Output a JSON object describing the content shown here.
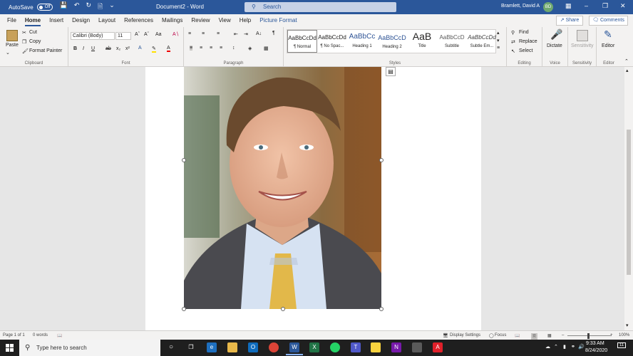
{
  "titlebar": {
    "autosave_label": "AutoSave",
    "autosave_state": "Off",
    "doc_title": "Document2  -  Word",
    "search_placeholder": "Search",
    "user_name": "Bramlett, David A",
    "user_initials": "BD"
  },
  "tabs": [
    "File",
    "Home",
    "Insert",
    "Design",
    "Layout",
    "References",
    "Mailings",
    "Review",
    "View",
    "Help",
    "Picture Format"
  ],
  "share_label": "Share",
  "comments_label": "Comments",
  "clipboard": {
    "paste": "Paste",
    "cut": "Cut",
    "copy": "Copy",
    "format_painter": "Format Painter",
    "group_label": "Clipboard"
  },
  "font": {
    "name": "Calibri (Body)",
    "size": "11",
    "group_label": "Font"
  },
  "paragraph": {
    "group_label": "Paragraph"
  },
  "styles": {
    "group_label": "Styles",
    "items": [
      {
        "preview": "AaBbCcDd",
        "name": "¶ Normal"
      },
      {
        "preview": "AaBbCcDd",
        "name": "¶ No Spac..."
      },
      {
        "preview": "AaBbCc",
        "name": "Heading 1"
      },
      {
        "preview": "AaBbCcD",
        "name": "Heading 2"
      },
      {
        "preview": "AaB",
        "name": "Title"
      },
      {
        "preview": "AaBbCcD",
        "name": "Subtitle"
      },
      {
        "preview": "AaBbCcDd",
        "name": "Subtle Em..."
      }
    ]
  },
  "editing": {
    "find": "Find",
    "replace": "Replace",
    "select": "Select",
    "group_label": "Editing"
  },
  "voice": {
    "dictate": "Dictate",
    "group_label": "Voice"
  },
  "sensitivity": {
    "label": "Sensitivity",
    "group_label": "Sensitivity"
  },
  "editor": {
    "label": "Editor",
    "group_label": "Editor"
  },
  "statusbar": {
    "page": "Page 1 of 1",
    "words": "0 words",
    "display_settings": "Display Settings",
    "focus": "Focus",
    "zoom": "100%"
  },
  "taskbar": {
    "search_placeholder": "Type here to search",
    "time": "9:33 AM",
    "date": "8/24/2020",
    "notifications": "11"
  },
  "colors": {
    "word_blue": "#2b579a",
    "ribbon_bg": "#f3f2f1",
    "taskbar_bg": "#1f1f1f"
  }
}
